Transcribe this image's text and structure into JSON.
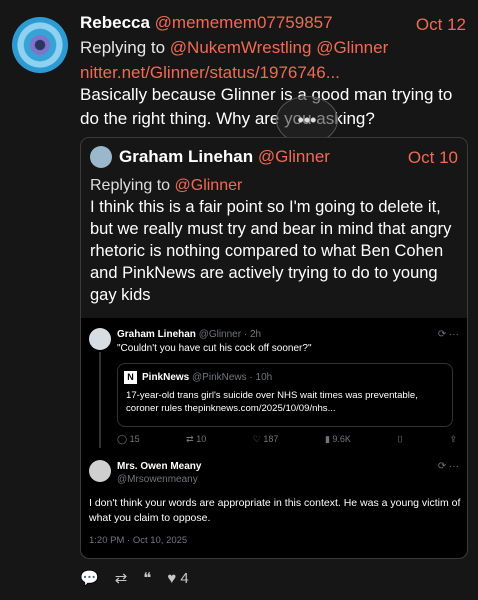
{
  "post": {
    "author_name": "Rebecca",
    "author_handle": "@mememem07759857",
    "date": "Oct 12",
    "reply_prefix": "Replying to",
    "reply_to_1": "@NukemWrestling",
    "reply_to_2": "@Glinner",
    "link": "nitter.net/Glinner/status/1976746...",
    "text": "Basically because Glinner is a good man trying to do the right thing. Why are you asking?"
  },
  "quote": {
    "author_name": "Graham Linehan",
    "author_handle": "@Glinner",
    "date": "Oct 10",
    "reply_prefix": "Replying to",
    "reply_to": "@Glinner",
    "text": "I think this is a fair point so I'm going to delete it, but we really must try and bear in mind that angry rhetoric is nothing compared to what Ben Cohen and PinkNews are actively trying to do to young gay kids"
  },
  "screenshot": {
    "tweet1_name": "Graham Linehan",
    "tweet1_meta": "@Glinner · 2h",
    "tweet1_text": "\"Couldn't you have cut his cock off sooner?\"",
    "card_logo": "N",
    "card_name": "PinkNews",
    "card_meta": "@PinkNews · 10h",
    "card_text": "17-year-old trans girl's suicide over NHS wait times was preventable, coroner rules thepinknews.com/2025/10/09/nhs...",
    "actions": {
      "replies": "15",
      "retweets": "10",
      "likes": "187",
      "views": "9.6K"
    },
    "tweet2_name": "Mrs. Owen Meany",
    "tweet2_handle": "@Mrsowenmeany",
    "tweet2_text": "I don't think your words are appropriate in this context. He was a young victim of what you claim to oppose.",
    "tweet2_time": "1:20 PM · Oct 10, 2025"
  },
  "bottom": {
    "likes": "4"
  }
}
